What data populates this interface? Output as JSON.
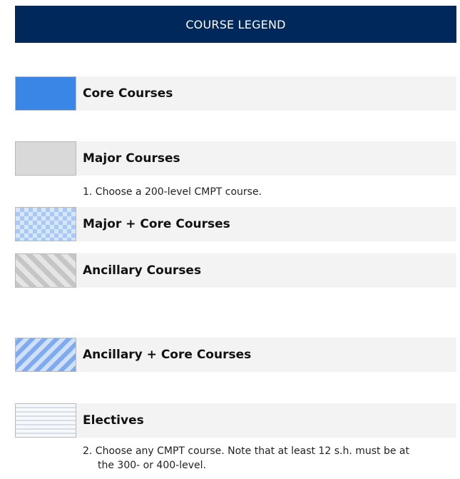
{
  "header": {
    "title": "COURSE LEGEND"
  },
  "legend": {
    "items": [
      {
        "label": "Core Courses",
        "pattern": "solid",
        "color": "#3a86e6"
      },
      {
        "label": "Major Courses",
        "pattern": "solid",
        "color": "#d9d9d9"
      },
      {
        "label": "Major + Core Courses",
        "pattern": "checkered",
        "color": "#a9c8f3"
      },
      {
        "label": "Ancillary Courses",
        "pattern": "diagonal-stripes",
        "color": "#c6c6c6"
      },
      {
        "label": "Ancillary + Core Courses",
        "pattern": "diagonal-stripes",
        "color": "#7faaf0"
      },
      {
        "label": "Electives",
        "pattern": "horizontal-lines",
        "color": "#d6dde6"
      }
    ]
  },
  "notes": {
    "note_1": "1. Choose a 200-level CMPT course.",
    "note_2_line_1": "2. Choose any CMPT course. Note that at least 12 s.h. must be at",
    "note_2_line_2": "the 300- or 400-level."
  },
  "colors": {
    "header_bg": "#00285a",
    "row_bg": "#f3f3f3"
  }
}
